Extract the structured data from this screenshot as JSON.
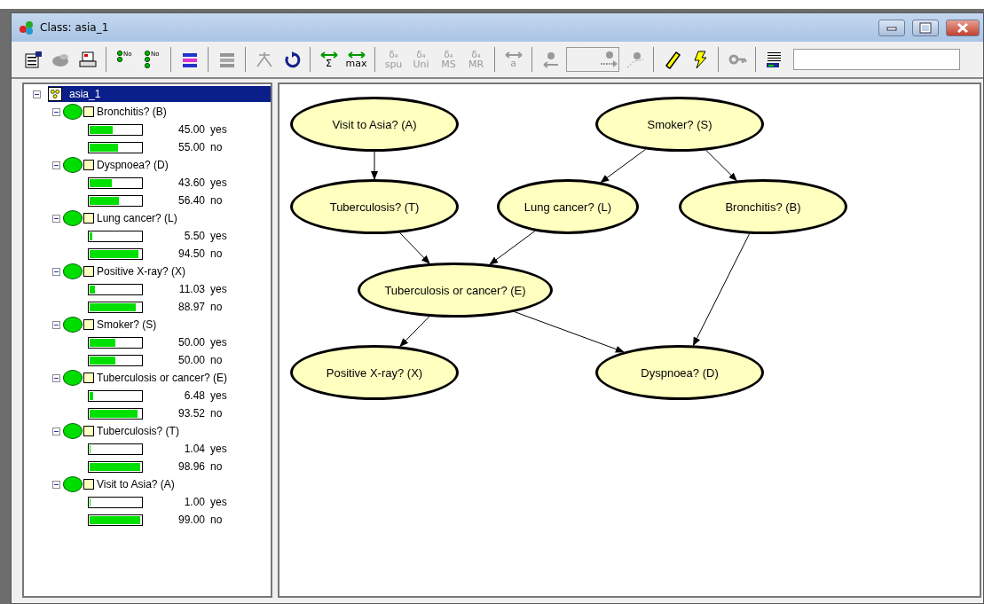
{
  "window": {
    "title": "Class: asia_1"
  },
  "toolbar": [
    {
      "kind": "properties",
      "disabled": false
    },
    {
      "kind": "blob",
      "disabled": true
    },
    {
      "kind": "printer",
      "disabled": false
    },
    {
      "kind": "separator"
    },
    {
      "kind": "node-list",
      "disabled": false,
      "label": "No"
    },
    {
      "kind": "node-list-all",
      "disabled": false,
      "label": "No"
    },
    {
      "kind": "separator"
    },
    {
      "kind": "bars",
      "disabled": false
    },
    {
      "kind": "separator"
    },
    {
      "kind": "bars",
      "disabled": true
    },
    {
      "kind": "separator"
    },
    {
      "kind": "tree",
      "disabled": true
    },
    {
      "kind": "refresh",
      "disabled": false
    },
    {
      "kind": "separator"
    },
    {
      "kind": "propagate",
      "disabled": false,
      "label": "Σ"
    },
    {
      "kind": "propagate",
      "disabled": false,
      "label": "max"
    },
    {
      "kind": "separator"
    },
    {
      "kind": "delta",
      "disabled": true,
      "top": "δ₄",
      "label": "spu"
    },
    {
      "kind": "delta",
      "disabled": true,
      "top": "δ₄",
      "label": "Uni"
    },
    {
      "kind": "delta",
      "disabled": true,
      "top": "δ₄",
      "label": "MS"
    },
    {
      "kind": "delta",
      "disabled": true,
      "top": "δ₄",
      "label": "MR"
    },
    {
      "kind": "separator"
    },
    {
      "kind": "propagate",
      "disabled": true,
      "label": "a"
    },
    {
      "kind": "separator"
    },
    {
      "kind": "back",
      "disabled": true
    },
    {
      "kind": "combo",
      "disabled": true
    },
    {
      "kind": "scatter",
      "disabled": true
    },
    {
      "kind": "separator"
    },
    {
      "kind": "pencil",
      "disabled": false
    },
    {
      "kind": "lightning",
      "disabled": false
    },
    {
      "kind": "separator"
    },
    {
      "kind": "key",
      "disabled": true
    },
    {
      "kind": "separator"
    },
    {
      "kind": "table",
      "disabled": false
    },
    {
      "kind": "field"
    }
  ],
  "tree": {
    "root": {
      "label": "asia_1",
      "selected": true,
      "expanded": true
    },
    "nodes": [
      {
        "label": "Bronchitis? (B)",
        "expanded": true,
        "states": [
          {
            "value": "45.00",
            "name": "yes",
            "level": 0.45
          },
          {
            "value": "55.00",
            "name": "no",
            "level": 0.55
          }
        ]
      },
      {
        "label": "Dyspnoea? (D)",
        "expanded": true,
        "states": [
          {
            "value": "43.60",
            "name": "yes",
            "level": 0.436
          },
          {
            "value": "56.40",
            "name": "no",
            "level": 0.564
          }
        ]
      },
      {
        "label": "Lung cancer? (L)",
        "expanded": true,
        "states": [
          {
            "value": "5.50",
            "name": "yes",
            "level": 0.055
          },
          {
            "value": "94.50",
            "name": "no",
            "level": 0.945
          }
        ]
      },
      {
        "label": "Positive X-ray? (X)",
        "expanded": true,
        "states": [
          {
            "value": "11.03",
            "name": "yes",
            "level": 0.1103
          },
          {
            "value": "88.97",
            "name": "no",
            "level": 0.8897
          }
        ]
      },
      {
        "label": "Smoker? (S)",
        "expanded": true,
        "states": [
          {
            "value": "50.00",
            "name": "yes",
            "level": 0.5
          },
          {
            "value": "50.00",
            "name": "no",
            "level": 0.5
          }
        ]
      },
      {
        "label": "Tuberculosis or cancer? (E)",
        "expanded": true,
        "states": [
          {
            "value": "6.48",
            "name": "yes",
            "level": 0.0648
          },
          {
            "value": "93.52",
            "name": "no",
            "level": 0.9352
          }
        ]
      },
      {
        "label": "Tuberculosis? (T)",
        "expanded": true,
        "states": [
          {
            "value": "1.04",
            "name": "yes",
            "level": 0.0104
          },
          {
            "value": "98.96",
            "name": "no",
            "level": 0.9896
          }
        ]
      },
      {
        "label": "Visit to Asia? (A)",
        "expanded": true,
        "states": [
          {
            "value": "1.00",
            "name": "yes",
            "level": 0.01
          },
          {
            "value": "99.00",
            "name": "no",
            "level": 0.99
          }
        ]
      }
    ]
  },
  "network": {
    "nodes": [
      {
        "label": "Visit to Asia? (A)"
      },
      {
        "label": "Smoker? (S)"
      },
      {
        "label": "Tuberculosis? (T)"
      },
      {
        "label": "Lung cancer? (L)"
      },
      {
        "label": "Bronchitis? (B)"
      },
      {
        "label": "Tuberculosis or cancer? (E)"
      },
      {
        "label": "Positive X-ray? (X)"
      },
      {
        "label": "Dyspnoea? (D)"
      }
    ]
  }
}
